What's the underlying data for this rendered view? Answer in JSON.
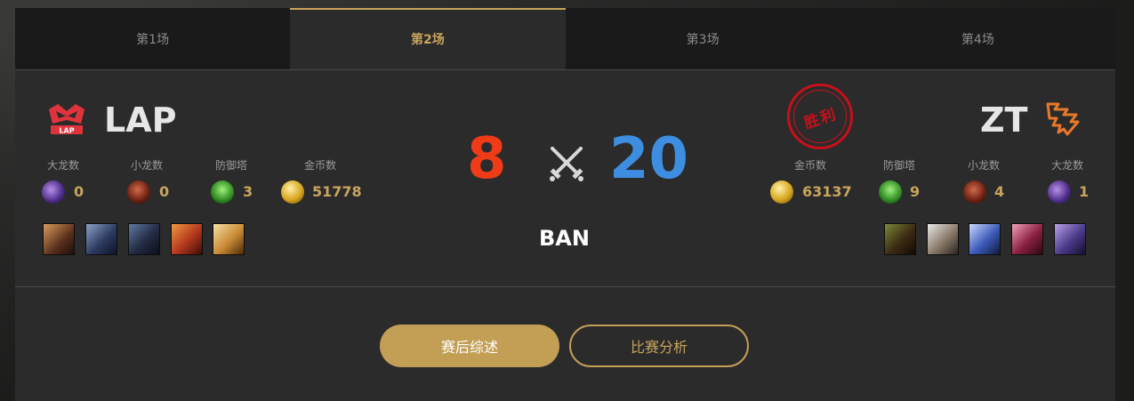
{
  "tabs": [
    {
      "label": "第1场"
    },
    {
      "label": "第2场"
    },
    {
      "label": "第3场"
    },
    {
      "label": "第4场"
    }
  ],
  "active_tab": 1,
  "left_team": {
    "name": "LAP",
    "logo_text": "LAP",
    "stats": [
      {
        "label": "大龙数",
        "value": "0",
        "icon": "baron-icon"
      },
      {
        "label": "小龙数",
        "value": "0",
        "icon": "dragon-icon"
      },
      {
        "label": "防御塔",
        "value": "3",
        "icon": "tower-icon"
      },
      {
        "label": "金币数",
        "value": "51778",
        "icon": "gold-icon"
      }
    ],
    "champions": [
      "champion-portrait",
      "champion-portrait",
      "champion-portrait",
      "champion-portrait",
      "champion-portrait"
    ]
  },
  "right_team": {
    "name": "ZT",
    "stats": [
      {
        "label": "金币数",
        "value": "63137",
        "icon": "gold-icon"
      },
      {
        "label": "防御塔",
        "value": "9",
        "icon": "tower-icon"
      },
      {
        "label": "小龙数",
        "value": "4",
        "icon": "dragon-icon"
      },
      {
        "label": "大龙数",
        "value": "1",
        "icon": "baron-icon"
      }
    ],
    "champions": [
      "champion-portrait",
      "champion-portrait",
      "champion-portrait",
      "champion-portrait",
      "champion-portrait"
    ],
    "result_stamp": "胜利"
  },
  "score": {
    "left": "8",
    "right": "20",
    "icon": "crossed-swords-icon"
  },
  "ban_label": "BAN",
  "buttons": {
    "summary": "赛后综述",
    "analysis": "比赛分析"
  },
  "colors": {
    "accent_gold": "#c39f56",
    "left_score": "#ef3b18",
    "right_score": "#3d8ee0",
    "stamp_red": "#c8101a"
  }
}
